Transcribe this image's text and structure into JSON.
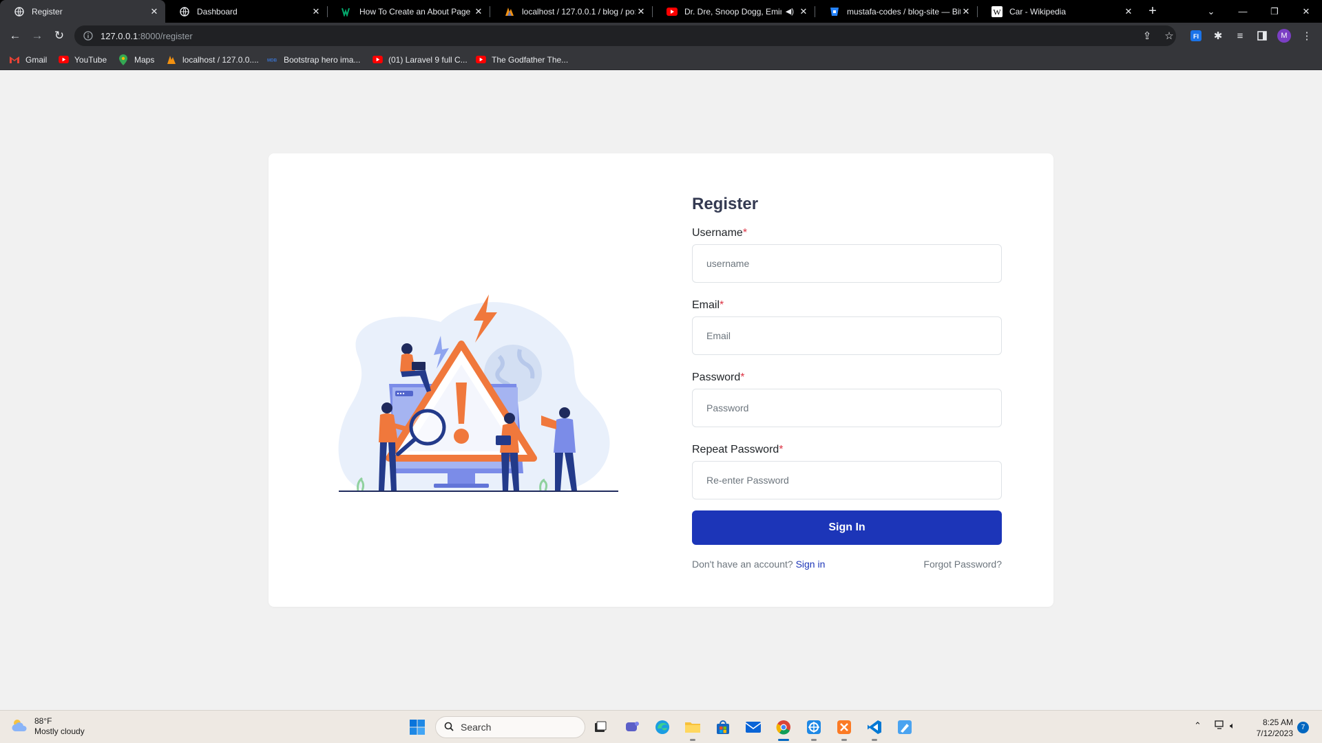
{
  "browser": {
    "tabs": [
      {
        "title": "Register",
        "favicon": "globe-icon",
        "active": true
      },
      {
        "title": "Dashboard",
        "favicon": "globe-icon"
      },
      {
        "title": "How To Create an About Page",
        "favicon": "w3schools-icon"
      },
      {
        "title": "localhost / 127.0.0.1 / blog / po:",
        "favicon": "phpmyadmin-icon"
      },
      {
        "title": "Dr. Dre, Snoop Dogg, Emine",
        "favicon": "youtube-icon",
        "audio": true
      },
      {
        "title": "mustafa-codes / blog-site — Bit",
        "favicon": "bitbucket-icon"
      },
      {
        "title": "Car - Wikipedia",
        "favicon": "wikipedia-icon"
      }
    ],
    "url_host": "127.0.0.1",
    "url_path": ":8000/register",
    "profile_initial": "M",
    "bookmarks": [
      {
        "label": "Gmail",
        "icon": "gmail-icon"
      },
      {
        "label": "YouTube",
        "icon": "youtube-icon"
      },
      {
        "label": "Maps",
        "icon": "maps-icon"
      },
      {
        "label": "localhost / 127.0.0....",
        "icon": "phpmyadmin-icon"
      },
      {
        "label": "Bootstrap hero ima...",
        "icon": "mdb-icon"
      },
      {
        "label": "(01) Laravel 9 full C...",
        "icon": "youtube-icon"
      },
      {
        "label": "The Godfather The...",
        "icon": "youtube-icon"
      }
    ]
  },
  "form": {
    "heading": "Register",
    "required_mark": "*",
    "fields": [
      {
        "label": "Username",
        "placeholder": "username"
      },
      {
        "label": "Email",
        "placeholder": "Email"
      },
      {
        "label": "Password",
        "placeholder": "Password"
      },
      {
        "label": "Repeat Password",
        "placeholder": "Re-enter Password"
      }
    ],
    "submit_label": "Sign In",
    "no_account_text": "Don't have an account?",
    "sign_in_link": "Sign in",
    "forgot_link": "Forgot Password?"
  },
  "taskbar": {
    "weather_temp": "88°F",
    "weather_desc": "Mostly cloudy",
    "search_label": "Search",
    "time": "8:25 AM",
    "date": "7/12/2023",
    "notification_count": "7"
  },
  "colors": {
    "primary": "#1c35b8",
    "heading": "#343a52",
    "required": "#dc3545",
    "illustration_orange": "#f0783c",
    "illustration_blue": "#7b8ce8"
  }
}
